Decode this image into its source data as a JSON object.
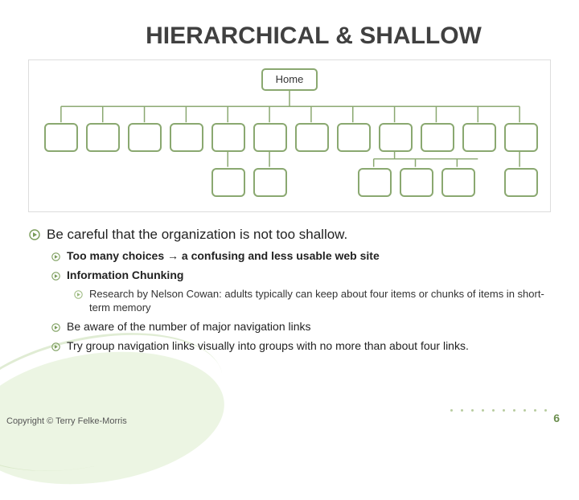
{
  "title": "HIERARCHICAL & SHALLOW",
  "diagram": {
    "root": "Home"
  },
  "bullets": {
    "main": "Be careful that the organization is not too shallow.",
    "sub1_pre": "Too many choices ",
    "sub1_post": " a confusing and less usable web site",
    "sub2": "Information Chunking",
    "sub2a": "Research by Nelson Cowan: adults typically can keep about four items or chunks of items in short-term memory",
    "sub3": "Be aware of the number of major navigation links",
    "sub4": "Try group navigation links visually into groups with no more than about four links."
  },
  "footer": "Copyright © Terry Felke-Morris",
  "page": "6",
  "arrow": "→"
}
